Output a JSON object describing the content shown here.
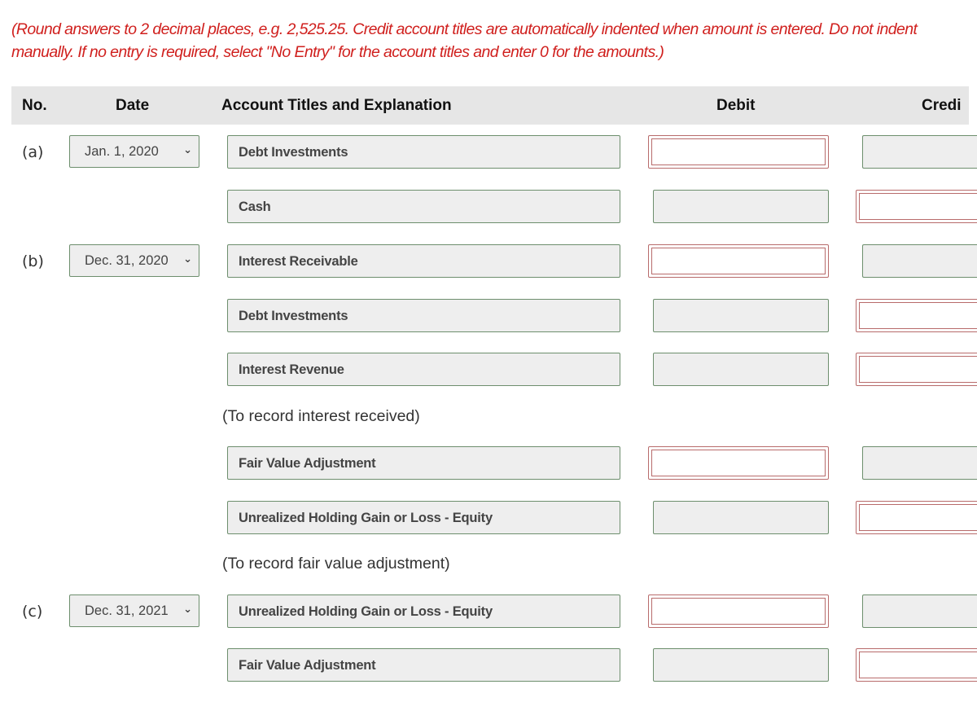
{
  "instructions": "(Round answers to 2 decimal places, e.g. 2,525.25. Credit account titles are automatically indented when amount is entered. Do not indent manually. If no entry is required, select \"No Entry\" for the account titles and enter 0 for the amounts.)",
  "colors": {
    "instruction_text": "#d0201e",
    "header_bg": "#e6e6e6",
    "field_border_correct": "#6d8e6d",
    "field_border_empty": "#b86b6b",
    "field_bg": "#eeeeee"
  },
  "table": {
    "headers": {
      "no": "No.",
      "date": "Date",
      "account": "Account Titles and Explanation",
      "debit": "Debit",
      "credit": "Credi"
    },
    "rows": [
      {
        "label": "(a)",
        "date": "Jan. 1, 2020",
        "account": "Debt Investments",
        "debit": "",
        "credit": ""
      },
      {
        "label": "",
        "date": "",
        "account": "Cash",
        "debit": "",
        "credit": ""
      },
      {
        "label": "(b)",
        "date": "Dec. 31, 2020",
        "account": "Interest Receivable",
        "debit": "",
        "credit": ""
      },
      {
        "label": "",
        "date": "",
        "account": "Debt Investments",
        "debit": "",
        "credit": ""
      },
      {
        "label": "",
        "date": "",
        "account": "Interest Revenue",
        "debit": "",
        "credit": ""
      },
      {
        "label": "",
        "date": "",
        "account": "Fair Value Adjustment",
        "debit": "",
        "credit": ""
      },
      {
        "label": "",
        "date": "",
        "account": "Unrealized Holding Gain or Loss - Equity",
        "debit": "",
        "credit": ""
      },
      {
        "label": "(c)",
        "date": "Dec. 31, 2021",
        "account": "Unrealized Holding Gain or Loss - Equity",
        "debit": "",
        "credit": ""
      },
      {
        "label": "",
        "date": "",
        "account": "Fair Value Adjustment",
        "debit": "",
        "credit": ""
      }
    ],
    "notes": {
      "interest": "(To record interest received)",
      "fair_value": "(To record fair value adjustment)"
    }
  },
  "icons": {
    "dropdown": "chevron-down-icon"
  }
}
